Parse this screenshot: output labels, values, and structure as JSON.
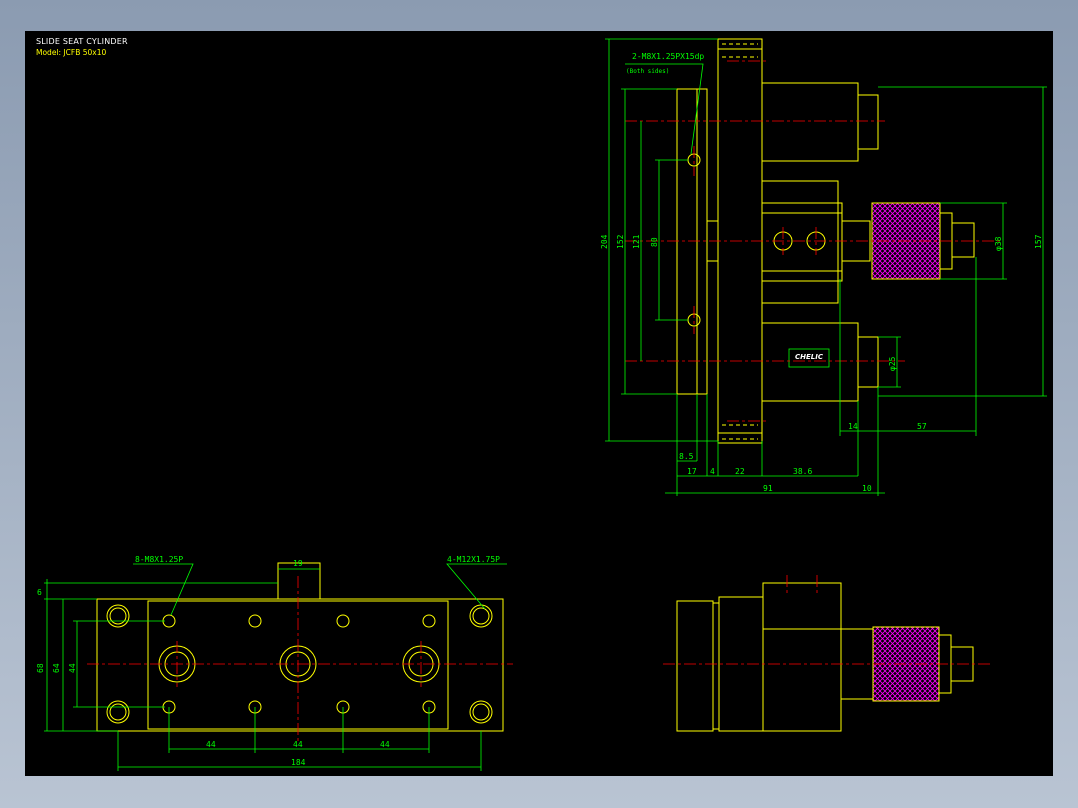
{
  "title": "SLIDE SEAT CYLINDER",
  "model": "Model: JCFB 50x10",
  "colors": {
    "background": "#000000",
    "outline": "#ffff00",
    "dimension": "#00ff00",
    "centerline": "#ff0000",
    "knurl": "#ff00ff",
    "text": "#ffffff"
  },
  "side_view": {
    "callout_line1": "2-M8X1.25PX15dp",
    "callout_line2": "(Both sides)",
    "dims": {
      "d204": "204",
      "d152": "152",
      "d121": "121",
      "d80": "80",
      "d157": "157",
      "d38": "φ38",
      "d25": "φ25",
      "d8_5": "8.5",
      "d17": "17",
      "d4": "4",
      "d22": "22",
      "d38_6": "38.6",
      "d91": "91",
      "d10": "10",
      "d14": "14",
      "d57": "57"
    },
    "label": "CHELIC"
  },
  "bottom_view": {
    "callout_left": "8-M8X1.25P",
    "callout_right": "4-M12X1.75P",
    "dims": {
      "d19": "19",
      "d6": "6",
      "d68": "68",
      "d64": "64",
      "d44v": "44",
      "d44a": "44",
      "d44b": "44",
      "d44c": "44",
      "d184": "184"
    }
  }
}
